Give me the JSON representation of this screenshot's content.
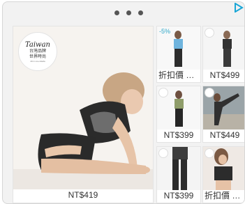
{
  "ad": {
    "choices_icon": "ad-choices-triangle-icon",
    "menu_icon": "more-dots-icon",
    "colors": {
      "accent": "#2fa8c8",
      "text": "#333333",
      "frame": "#f2f2f2"
    }
  },
  "main": {
    "logo": {
      "line1": "Taiwan",
      "line2": "台灣品牌",
      "line3": "世界時尚",
      "line4": "All in one Adella"
    },
    "price": "NT$419"
  },
  "products": [
    {
      "price": "折扣價 NT$...",
      "discount": "-5%"
    },
    {
      "price": "NT$499",
      "discount": ""
    },
    {
      "price": "NT$399",
      "discount": ""
    },
    {
      "price": "NT$449",
      "discount": ""
    },
    {
      "price": "NT$399",
      "discount": ""
    },
    {
      "price": "折扣價 NT...",
      "discount": ""
    }
  ]
}
